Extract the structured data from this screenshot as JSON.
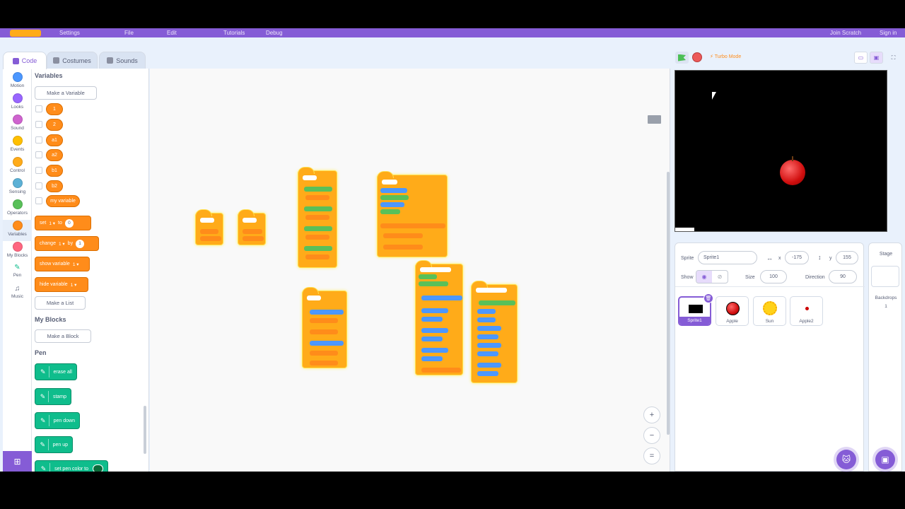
{
  "menubar": {
    "items": [
      "Settings",
      "File",
      "Edit",
      "Tutorials",
      "Debug"
    ],
    "right": [
      "Join Scratch",
      "Sign in"
    ]
  },
  "tabs": {
    "code": "Code",
    "costumes": "Costumes",
    "sounds": "Sounds"
  },
  "categories": [
    {
      "label": "Motion",
      "color": "#4c97ff"
    },
    {
      "label": "Looks",
      "color": "#9966ff"
    },
    {
      "label": "Sound",
      "color": "#cf63cf"
    },
    {
      "label": "Events",
      "color": "#ffbf00"
    },
    {
      "label": "Control",
      "color": "#ffab19"
    },
    {
      "label": "Sensing",
      "color": "#5cb1d6"
    },
    {
      "label": "Operators",
      "color": "#59c059"
    },
    {
      "label": "Variables",
      "color": "#ff8c1a"
    },
    {
      "label": "My Blocks",
      "color": "#ff6680"
    },
    {
      "label": "Pen",
      "color": "#0fbd8c"
    },
    {
      "label": "Music",
      "color": "#0fbd8c"
    }
  ],
  "palette": {
    "variables_heading": "Variables",
    "make_variable": "Make a Variable",
    "variables": [
      "1",
      "2",
      "a1",
      "a2",
      "b1",
      "b2",
      "my variable"
    ],
    "set_block": {
      "label": "set",
      "var": "1",
      "to": "to",
      "value": "0"
    },
    "change_block": {
      "label": "change",
      "var": "1",
      "by": "by",
      "value": "1"
    },
    "show_block": {
      "label": "show variable",
      "var": "1"
    },
    "hide_block": {
      "label": "hide variable",
      "var": "1"
    },
    "make_list": "Make a List",
    "myblocks_heading": "My Blocks",
    "make_block": "Make a Block",
    "pen_heading": "Pen",
    "pen_blocks": [
      "erase all",
      "stamp",
      "pen down",
      "pen up",
      "set pen color to"
    ]
  },
  "zoom": {
    "in": "+",
    "out": "−",
    "reset": "="
  },
  "stage_controls": {
    "turbo": "Turbo Mode"
  },
  "sprite_info": {
    "sprite_label": "Sprite",
    "sprite_name": "Sprite1",
    "x_label": "x",
    "x_value": "-175",
    "y_label": "y",
    "y_value": "155",
    "show_label": "Show",
    "size_label": "Size",
    "size_value": "100",
    "direction_label": "Direction",
    "direction_value": "90"
  },
  "sprites": [
    "Sprite1",
    "Apple",
    "Sun",
    "Apple2"
  ],
  "stage_pane": {
    "title": "Stage",
    "backdrops_label": "Backdrops",
    "backdrops_count": "1"
  },
  "colors": {
    "accent": "#855cd6",
    "control": "#ffab19",
    "variables": "#ff8c1a",
    "pen": "#0fbd8c"
  }
}
